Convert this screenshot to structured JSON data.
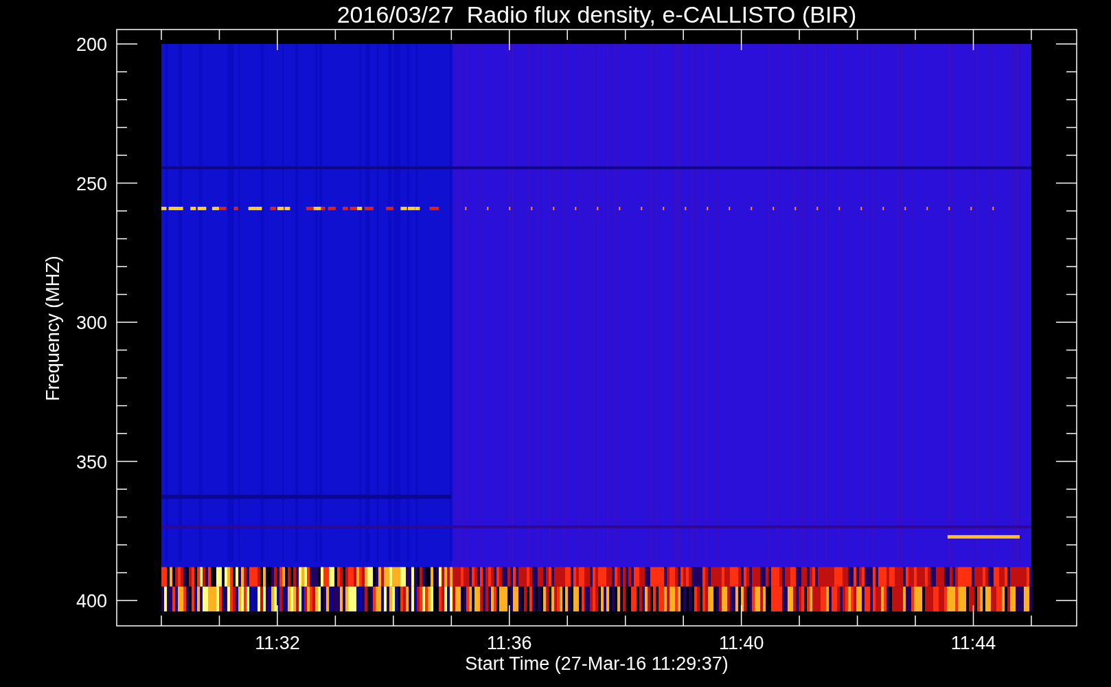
{
  "title": "2016/03/27  Radio flux density, e-CALLISTO (BIR)",
  "y_axis": {
    "label": "Frequency (MHZ)",
    "ticks": [
      "200",
      "250",
      "300",
      "350",
      "400"
    ]
  },
  "x_axis": {
    "label": "Start Time (27-Mar-16 11:29:37)",
    "ticks": [
      "11:32",
      "11:36",
      "11:40",
      "11:44"
    ]
  }
}
